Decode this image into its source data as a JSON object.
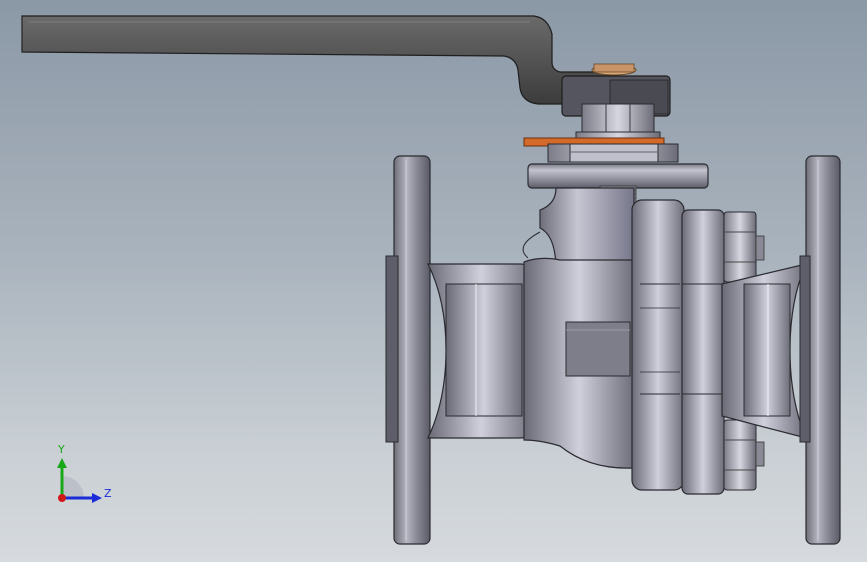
{
  "triad": {
    "y_label": "Y",
    "z_label": "Z",
    "y_color": "#18a818",
    "z_color": "#1a2cd8",
    "x_color": "#d01818"
  },
  "model": {
    "lever_color": "#4a4a4a",
    "body_color": "#9a9aa6",
    "gasket_color": "#d46a2a"
  }
}
